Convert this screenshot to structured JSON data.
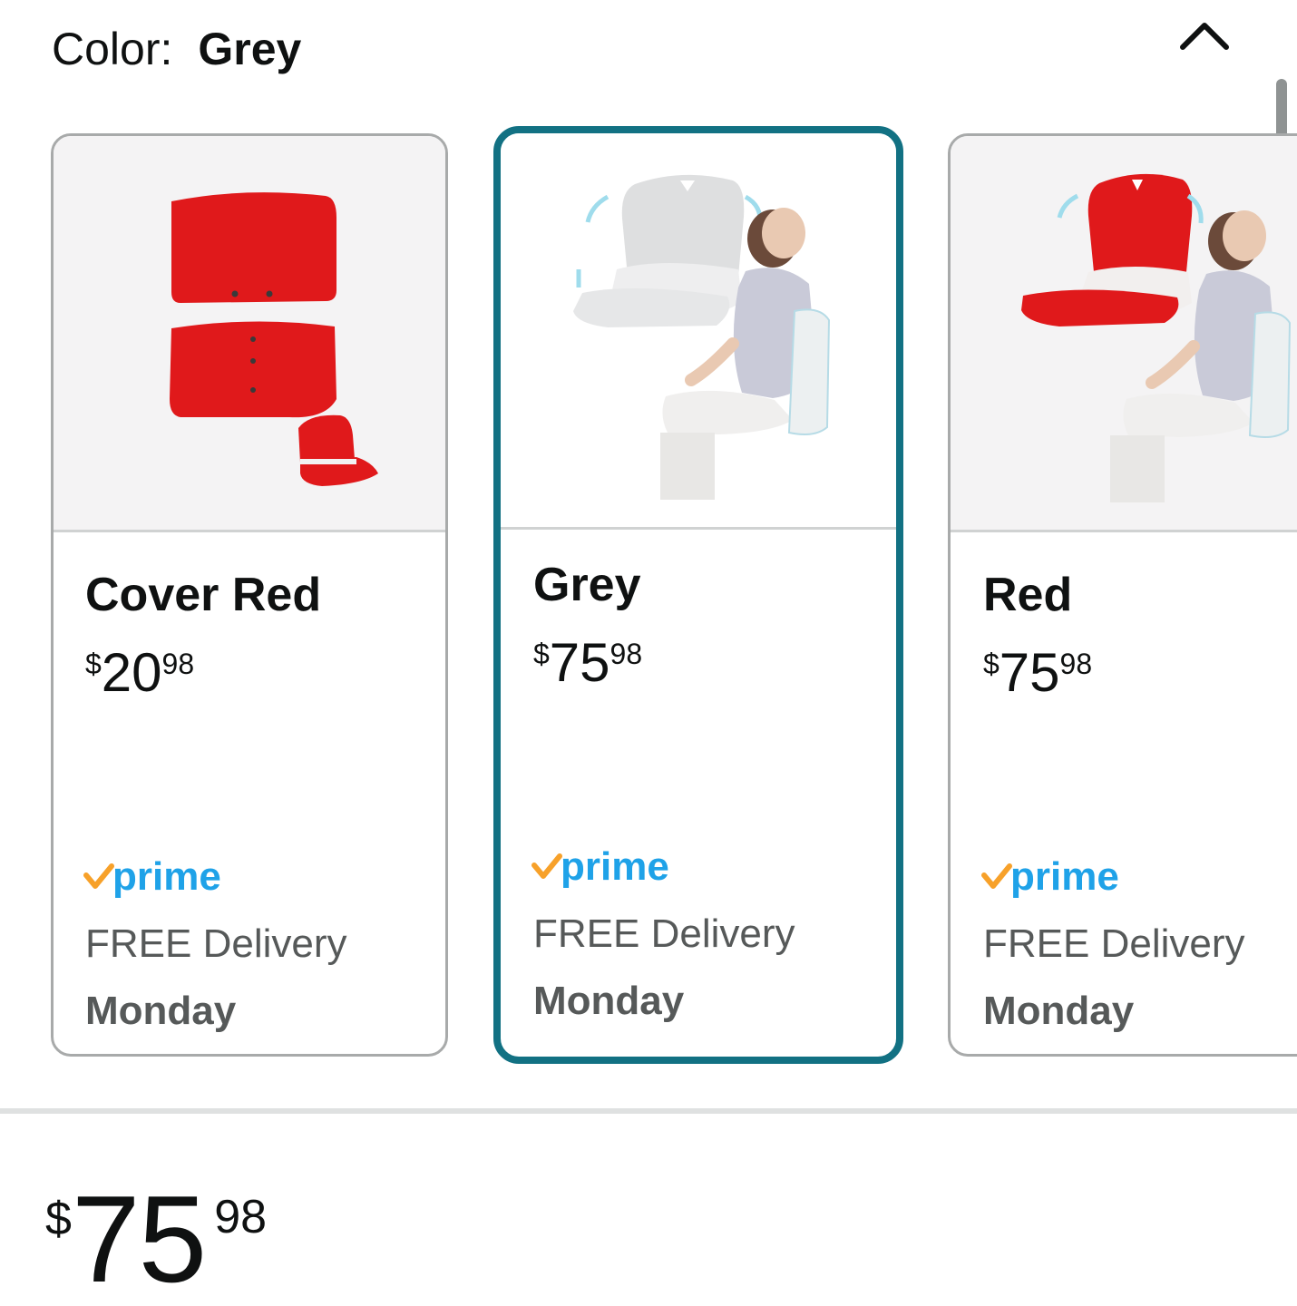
{
  "header": {
    "color_label": "Color:",
    "selected_color": "Grey"
  },
  "icons": {
    "collapse": "chevron-up-icon",
    "prime_check": "prime-check-icon"
  },
  "colors": {
    "selected_border": "#127183",
    "prime_blue": "#1fa2e8",
    "prime_orange": "#f7a12a",
    "product_red": "#e0191b"
  },
  "variants": [
    {
      "name": "Cover Red",
      "price": {
        "currency": "$",
        "whole": "20",
        "fraction": "98"
      },
      "prime": "prime",
      "delivery": "FREE Delivery",
      "delivery_day": "Monday",
      "selected": false
    },
    {
      "name": "Grey",
      "price": {
        "currency": "$",
        "whole": "75",
        "fraction": "98"
      },
      "prime": "prime",
      "delivery": "FREE Delivery",
      "delivery_day": "Monday",
      "selected": true
    },
    {
      "name": "Red",
      "price": {
        "currency": "$",
        "whole": "75",
        "fraction": "98"
      },
      "prime": "prime",
      "delivery": "FREE Delivery",
      "delivery_day": "Monday",
      "selected": false
    }
  ],
  "main_price": {
    "currency": "$",
    "whole": "75",
    "fraction": "98"
  }
}
